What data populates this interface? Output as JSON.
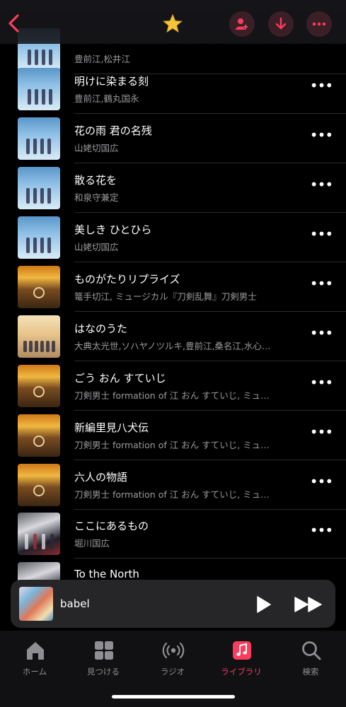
{
  "header": {
    "back_icon": "chevron-left-icon",
    "favorite_icon": "star-icon",
    "actions": [
      "add-person-icon",
      "download-icon",
      "more-icon"
    ],
    "accent_color": "#fc3c5c"
  },
  "tracks": [
    {
      "title": "",
      "artist": "豊前江,松井江",
      "art": "blue"
    },
    {
      "title": "明けに染まる刻",
      "artist": "豊前江,鶴丸国永",
      "art": "blue"
    },
    {
      "title": "花の雨 君の名残",
      "artist": "山姥切国広",
      "art": "blue"
    },
    {
      "title": "散る花を",
      "artist": "和泉守兼定",
      "art": "blue"
    },
    {
      "title": "美しき ひとひら",
      "artist": "山姥切国広",
      "art": "blue"
    },
    {
      "title": "ものがたりリプライズ",
      "artist": "篭手切江, ミュージカル『刀剣乱舞』刀剣男士",
      "art": "gold"
    },
    {
      "title": "はなのうた",
      "artist": "大典太光世,ソハヤノツルキ,豊前江,桑名江,水心…",
      "art": "cherry"
    },
    {
      "title": "ごう おん すていじ",
      "artist": "刀剣男士 formation of 江 おん すていじ, ミュ…",
      "art": "gold"
    },
    {
      "title": "新編里見八犬伝",
      "artist": "刀剣男士 formation of 江 おん すていじ, ミュ…",
      "art": "gold"
    },
    {
      "title": "六人の物語",
      "artist": "刀剣男士 formation of 江 おん すていじ, ミュ…",
      "art": "gold"
    },
    {
      "title": "ここにあるもの",
      "artist": "堀川国広",
      "art": "dark"
    },
    {
      "title": "To the North",
      "artist": "",
      "art": "dark"
    }
  ],
  "more_glyph": "•••",
  "now_playing": {
    "title": "babel",
    "play_icon": "play-icon",
    "forward_icon": "fast-forward-icon"
  },
  "tabs": [
    {
      "label": "ホーム",
      "icon": "home-icon",
      "active": false
    },
    {
      "label": "見つける",
      "icon": "grid-icon",
      "active": false
    },
    {
      "label": "ラジオ",
      "icon": "radio-icon",
      "active": false
    },
    {
      "label": "ライブラリ",
      "icon": "music-library-icon",
      "active": true
    },
    {
      "label": "検索",
      "icon": "search-icon",
      "active": false
    }
  ]
}
